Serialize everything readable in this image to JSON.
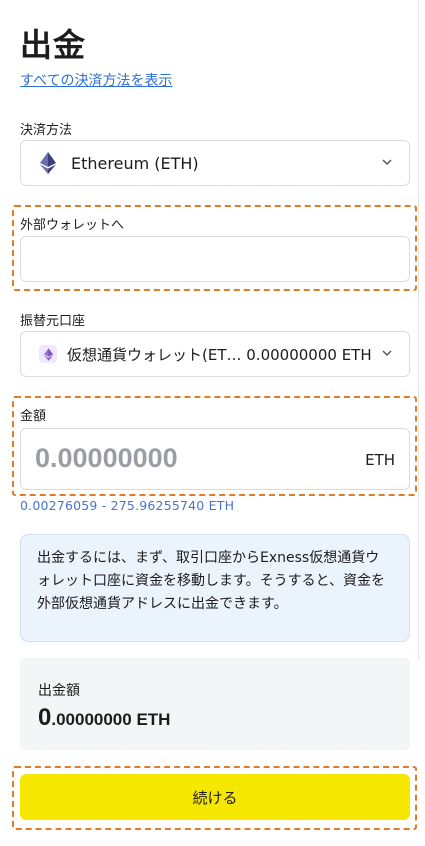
{
  "page": {
    "title": "出金",
    "all_methods_link": "すべての決済方法を表示"
  },
  "payment_method": {
    "label": "決済方法",
    "selected": "Ethereum (ETH)"
  },
  "external_wallet": {
    "label": "外部ウォレットへ",
    "value": ""
  },
  "source_account": {
    "label": "振替元口座",
    "selected": "仮想通貨ウォレット(ET… 0.00000000 ETH"
  },
  "amount": {
    "label": "金額",
    "value": "0.00000000",
    "unit": "ETH",
    "range": "0.00276059 - 275.96255740 ETH"
  },
  "info": {
    "text": "出金するには、まず、取引口座からExness仮想通貨ウォレット口座に資金を移動します。そうすると、資金を外部仮想通貨アドレスに出金できます。"
  },
  "summary": {
    "label": "出金額",
    "amount_integer": "0",
    "amount_rest": ".00000000 ETH"
  },
  "continue_button": {
    "label": "続ける"
  },
  "colors": {
    "highlight": "#e07b2a",
    "button": "#f5e700",
    "link": "#2d6ed4"
  }
}
